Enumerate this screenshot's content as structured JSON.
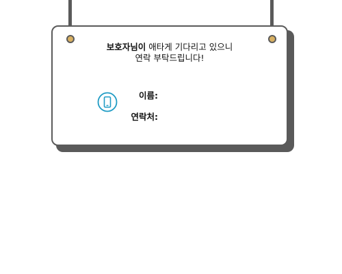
{
  "notice": {
    "line1_bold": "보호자님이",
    "line1_rest": " 애타게 기다리고 있으니",
    "line2": "연락 부탁드립니다!"
  },
  "fields": {
    "name_label": "이름:",
    "contact_label": "연락처:"
  },
  "icons": {
    "phone": "phone-icon"
  },
  "colors": {
    "frame": "#5a5a5a",
    "grommet": "#d8b062",
    "icon_accent": "#1e9bc4"
  }
}
